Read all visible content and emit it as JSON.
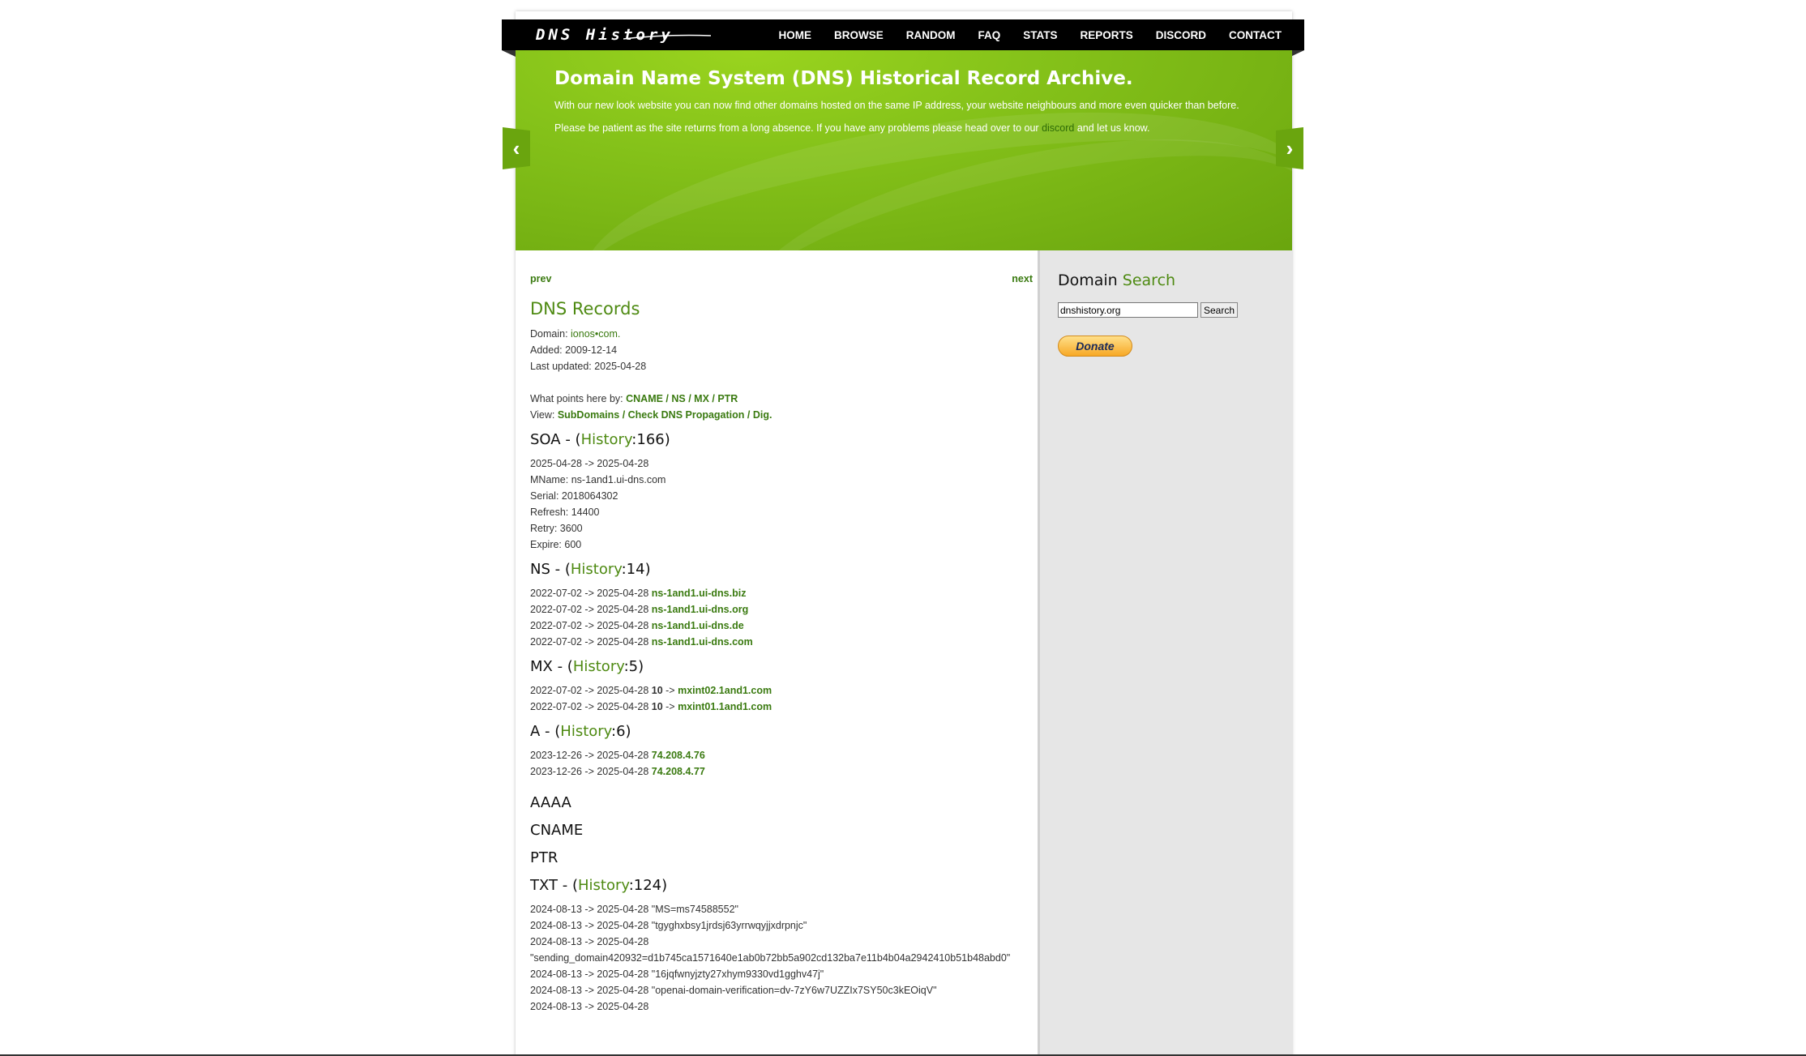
{
  "header": {
    "logo": "DNS History",
    "menu": [
      "HOME",
      "BROWSE",
      "RANDOM",
      "FAQ",
      "STATS",
      "REPORTS",
      "DISCORD",
      "CONTACT"
    ]
  },
  "banner": {
    "title": "Domain Name System (DNS) Historical Record Archive.",
    "para1": "With our new look website you can now find other domains hosted on the same IP address, your website neighbours and more even quicker than before.",
    "para2_before": "Please be patient as the site returns from a long absence. If you have any problems please head over to our ",
    "para2_link": "discord",
    "para2_after": " and let us know."
  },
  "pager": {
    "prev": "prev",
    "next": "next"
  },
  "records": {
    "title": "DNS Records",
    "domain_label": "Domain: ",
    "domain_value": "ionos•com.",
    "added": "Added: 2009-12-14",
    "updated": "Last updated: 2025-04-28",
    "points_label": "What points here by: ",
    "points_links": "CNAME / NS / MX / PTR",
    "view_label": "View: ",
    "view_links": "SubDomains / Check DNS Propagation / Dig."
  },
  "soa": {
    "prefix": "SOA - (",
    "link": "History",
    "suffix": ":166)",
    "lines": [
      "2025-04-28 -> 2025-04-28",
      "MName: ns-1and1.ui-dns.com",
      "Serial: 2018064302",
      "Refresh: 14400",
      "Retry: 3600",
      "Expire: 600"
    ]
  },
  "ns": {
    "prefix": "NS - (",
    "link": "History",
    "suffix": ":14)",
    "rows": [
      {
        "dates": "2022-07-02 -> 2025-04-28 ",
        "value": "ns-1and1.ui-dns.biz"
      },
      {
        "dates": "2022-07-02 -> 2025-04-28 ",
        "value": "ns-1and1.ui-dns.org"
      },
      {
        "dates": "2022-07-02 -> 2025-04-28 ",
        "value": "ns-1and1.ui-dns.de"
      },
      {
        "dates": "2022-07-02 -> 2025-04-28 ",
        "value": "ns-1and1.ui-dns.com"
      }
    ]
  },
  "mx": {
    "prefix": "MX - (",
    "link": "History",
    "suffix": ":5)",
    "rows": [
      {
        "dates": "2022-07-02 -> 2025-04-28 ",
        "prio": "10",
        "arrow": " -> ",
        "value": "mxint02.1and1.com"
      },
      {
        "dates": "2022-07-02 -> 2025-04-28 ",
        "prio": "10",
        "arrow": " -> ",
        "value": "mxint01.1and1.com"
      }
    ]
  },
  "a": {
    "prefix": "A - (",
    "link": "History",
    "suffix": ":6)",
    "rows": [
      {
        "dates": "2023-12-26 -> 2025-04-28 ",
        "value": "74.208.4.76"
      },
      {
        "dates": "2023-12-26 -> 2025-04-28 ",
        "value": "74.208.4.77"
      }
    ]
  },
  "aaaa": "AAAA",
  "cname": "CNAME",
  "ptr": "PTR",
  "txt": {
    "prefix": "TXT - (",
    "link": "History",
    "suffix": ":124)",
    "lines": [
      "2024-08-13 -> 2025-04-28 \"MS=ms74588552\"",
      "2024-08-13 -> 2025-04-28 \"tgyghxbsy1jrdsj63yrrwqyjjxdrpnjc\"",
      "2024-08-13 -> 2025-04-28",
      "\"sending_domain420932=d1b745ca1571640e1ab0b72bb5a902cd132ba7e11b4b04a2942410b51b48abd0\"",
      "2024-08-13 -> 2025-04-28 \"16jqfwnyjzty27xhym9330vd1gghv47j\"",
      "2024-08-13 -> 2025-04-28 \"openai-domain-verification=dv-7zY6w7UZZIx7SY50c3kEOiqV\"",
      "2024-08-13 -> 2025-04-28"
    ]
  },
  "sidebar": {
    "title_a": "Domain ",
    "title_b": "Search",
    "search_value": "dnshistory.org",
    "search_button": "Search",
    "donate": "Donate"
  }
}
